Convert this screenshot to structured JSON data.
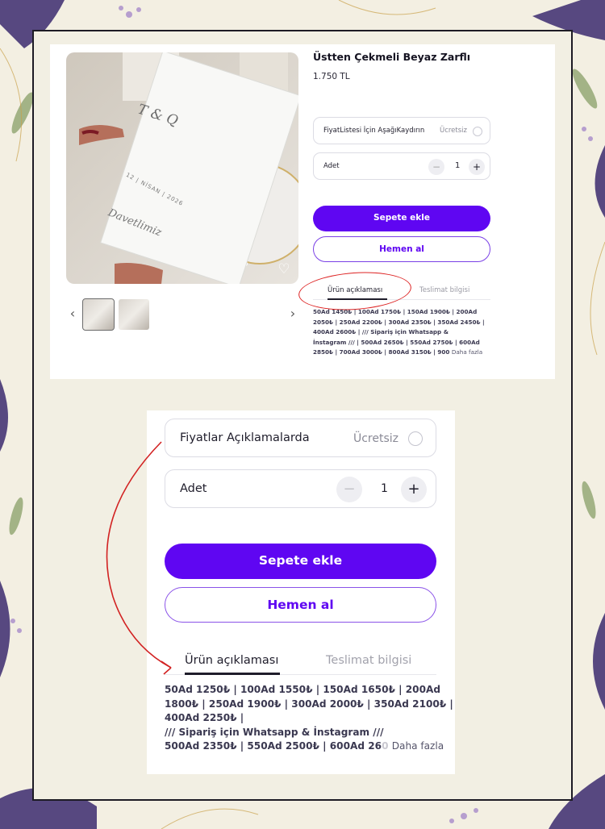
{
  "product": {
    "title": "Üstten Çekmeli Beyaz Zarflı",
    "price": "1.750 TL"
  },
  "top_card": {
    "option_label": "FiyatListesi İçin AşağıKaydırın",
    "option_free": "Ücretsiz",
    "qty_label": "Adet",
    "qty_minus": "−",
    "qty_value": "1",
    "qty_plus": "+",
    "add_to_cart": "Sepete ekle",
    "buy_now": "Hemen al",
    "tab_description": "Ürün açıklaması",
    "tab_delivery": "Teslimat bilgisi",
    "desc_lines": [
      "50Ad 1450₺ | 100Ad 1750₺ | 150Ad 1900₺ | 200Ad",
      "2050₺ | 250Ad 2200₺ | 300Ad 2350₺ | 350Ad 2450₺ |",
      " 400Ad 2600₺ |  /// Sipariş için Whatsapp &",
      "İnstagram ///  | 500Ad 2650₺ | 550Ad 2750₺ | 600Ad"
    ],
    "desc_last": "2850₺ | 700Ad 3000₺ | 800Ad 3150₺ | 900",
    "more": "Daha fazla",
    "card_photo_text": [
      "T & Q",
      "12 | NİSAN | 2026",
      "Davetlimiz"
    ]
  },
  "bottom_card": {
    "option_label": "Fiyatlar Açıklamalarda",
    "option_free": "Ücretsiz",
    "qty_label": "Adet",
    "qty_minus": "−",
    "qty_value": "1",
    "qty_plus": "+",
    "add_to_cart": "Sepete ekle",
    "buy_now": "Hemen al",
    "tab_description": "Ürün açıklaması",
    "tab_delivery": "Teslimat bilgisi",
    "desc_lines": [
      "50Ad 1250₺ | 100Ad 1550₺ | 150Ad 1650₺ | 200Ad",
      "1800₺ | 250Ad 1900₺ | 300Ad 2000₺ | 350Ad 2100₺ |",
      " 400Ad 2250₺ |",
      "/// Sipariş için Whatsapp & İnstagram ///"
    ],
    "desc_last": " 500Ad 2350₺ | 550Ad 2500₺ | 600Ad 26",
    "desc_fade": "0",
    "more": "Daha fazla"
  },
  "colors": {
    "accent": "#5f06f2",
    "annotation": "#d22222",
    "page_bg": "#f3efe2"
  }
}
